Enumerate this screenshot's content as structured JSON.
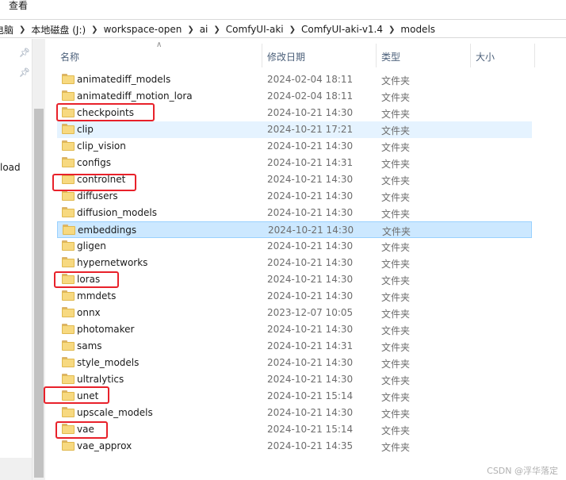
{
  "menubar": {
    "view_label": "查看"
  },
  "breadcrumb": {
    "items": [
      "电脑",
      "本地磁盘 (J:)",
      "workspace-open",
      "ai",
      "ComfyUI-aki",
      "ComfyUI-aki-v1.4",
      "models"
    ]
  },
  "nav": {
    "partial_label": "load"
  },
  "columns": {
    "name": "名称",
    "modified": "修改日期",
    "type": "类型",
    "size": "大小"
  },
  "files": [
    {
      "name": "animatediff_models",
      "modified": "2024-02-04 18:11",
      "type": "文件夹"
    },
    {
      "name": "animatediff_motion_lora",
      "modified": "2024-02-04 18:11",
      "type": "文件夹"
    },
    {
      "name": "checkpoints",
      "modified": "2024-10-21 14:30",
      "type": "文件夹"
    },
    {
      "name": "clip",
      "modified": "2024-10-21 17:21",
      "type": "文件夹"
    },
    {
      "name": "clip_vision",
      "modified": "2024-10-21 14:30",
      "type": "文件夹"
    },
    {
      "name": "configs",
      "modified": "2024-10-21 14:31",
      "type": "文件夹"
    },
    {
      "name": "controlnet",
      "modified": "2024-10-21 14:30",
      "type": "文件夹"
    },
    {
      "name": "diffusers",
      "modified": "2024-10-21 14:30",
      "type": "文件夹"
    },
    {
      "name": "diffusion_models",
      "modified": "2024-10-21 14:30",
      "type": "文件夹"
    },
    {
      "name": "embeddings",
      "modified": "2024-10-21 14:30",
      "type": "文件夹"
    },
    {
      "name": "gligen",
      "modified": "2024-10-21 14:30",
      "type": "文件夹"
    },
    {
      "name": "hypernetworks",
      "modified": "2024-10-21 14:30",
      "type": "文件夹"
    },
    {
      "name": "loras",
      "modified": "2024-10-21 14:30",
      "type": "文件夹"
    },
    {
      "name": "mmdets",
      "modified": "2024-10-21 14:30",
      "type": "文件夹"
    },
    {
      "name": "onnx",
      "modified": "2023-12-07 10:05",
      "type": "文件夹"
    },
    {
      "name": "photomaker",
      "modified": "2024-10-21 14:30",
      "type": "文件夹"
    },
    {
      "name": "sams",
      "modified": "2024-10-21 14:31",
      "type": "文件夹"
    },
    {
      "name": "style_models",
      "modified": "2024-10-21 14:30",
      "type": "文件夹"
    },
    {
      "name": "ultralytics",
      "modified": "2024-10-21 14:30",
      "type": "文件夹"
    },
    {
      "name": "unet",
      "modified": "2024-10-21 15:14",
      "type": "文件夹"
    },
    {
      "name": "upscale_models",
      "modified": "2024-10-21 14:30",
      "type": "文件夹"
    },
    {
      "name": "vae",
      "modified": "2024-10-21 15:14",
      "type": "文件夹"
    },
    {
      "name": "vae_approx",
      "modified": "2024-10-21 14:35",
      "type": "文件夹"
    }
  ],
  "watermark": "CSDN @浮华落定",
  "colors": {
    "highlight_box": "#e8212a",
    "selection": "#cce8ff",
    "hover": "#e5f3ff",
    "folder": "#f7d980"
  }
}
